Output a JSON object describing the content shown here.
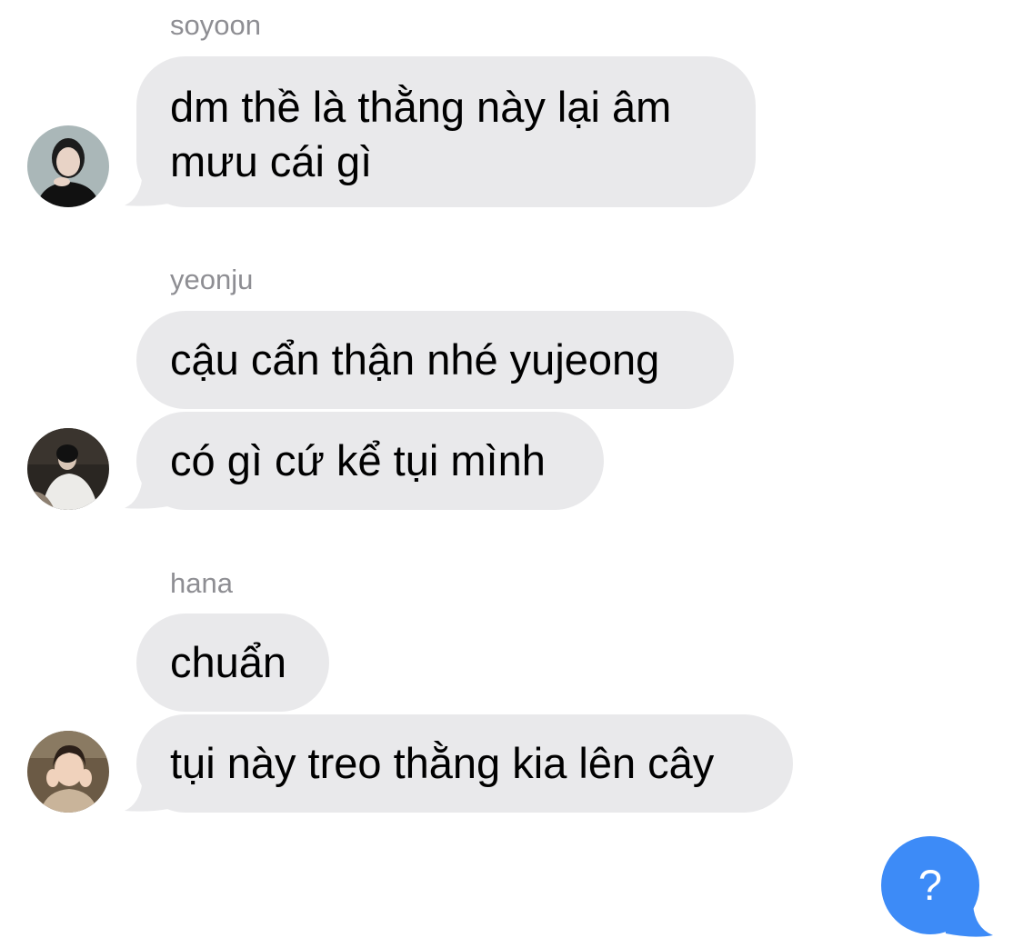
{
  "groups": [
    {
      "sender": "soyoon",
      "avatar_icon": "soyoon-avatar-photo",
      "messages": [
        "dm thề là thằng này lại âm",
        "mưu cái gì"
      ]
    },
    {
      "sender": "yeonju",
      "avatar_icon": "yeonju-avatar-photo",
      "messages": [
        "cậu cẩn thận nhé yujeong",
        "có gì cứ kể tụi mình"
      ]
    },
    {
      "sender": "hana",
      "avatar_icon": "hana-avatar-photo",
      "messages": [
        "chuẩn",
        "tụi này treo thằng kia lên cây"
      ]
    }
  ],
  "outgoing": {
    "text": "?"
  },
  "colors": {
    "incoming_bubble": "#e9e9eb",
    "outgoing_bubble": "#3d8bf7",
    "sender_name": "#8e8e93"
  }
}
